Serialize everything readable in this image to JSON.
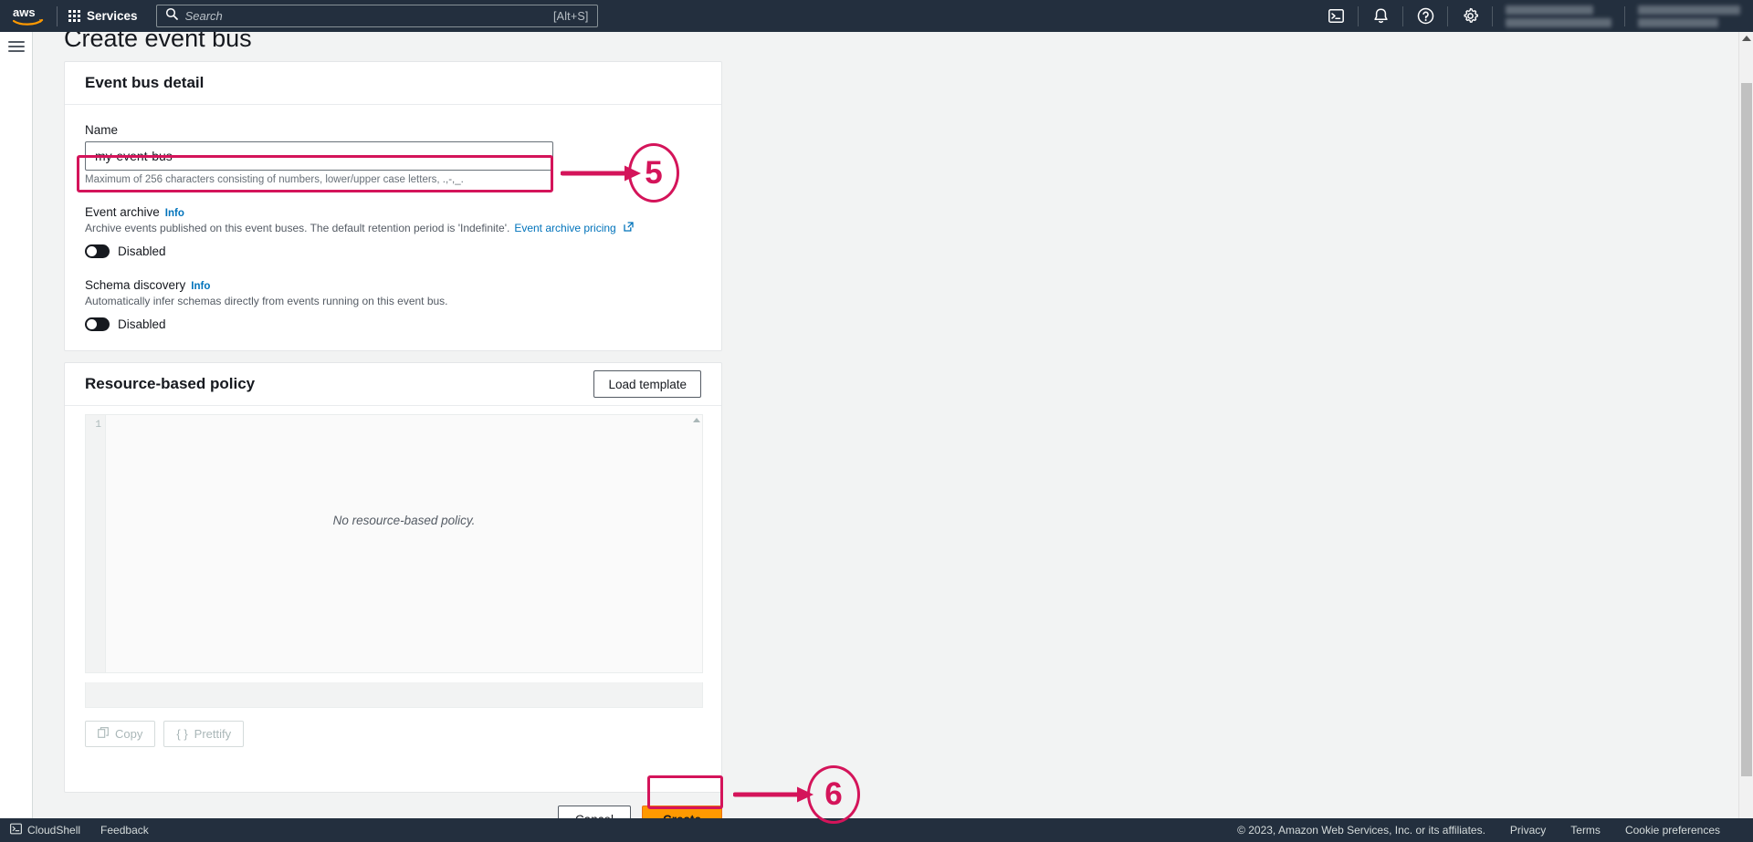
{
  "topnav": {
    "logo": "aws-logo",
    "services_label": "Services",
    "search_placeholder": "Search",
    "search_value": "",
    "search_hint": "[Alt+S]",
    "icons": [
      "cloudshell-icon",
      "bell-icon",
      "help-icon",
      "gear-icon"
    ],
    "account_blurred": "",
    "region_blurred": ""
  },
  "page": {
    "title": "Create event bus"
  },
  "detail_card": {
    "title": "Event bus detail",
    "name_label": "Name",
    "name_value": "my-event-bus",
    "name_placeholder": "",
    "name_hint": "Maximum of 256 characters consisting of numbers, lower/upper case letters, .,-,_.",
    "event_archive": {
      "label": "Event archive",
      "info": "Info",
      "description": "Archive events published on this event buses. The default retention period is 'Indefinite'.",
      "link": "Event archive pricing",
      "toggle_state": "Disabled"
    },
    "schema_discovery": {
      "label": "Schema discovery",
      "info": "Info",
      "description": "Automatically infer schemas directly from events running on this event bus.",
      "toggle_state": "Disabled"
    }
  },
  "policy_card": {
    "title": "Resource-based policy",
    "load_template_label": "Load template",
    "gutter_line": "1",
    "empty_text": "No resource-based policy.",
    "copy_label": "Copy",
    "prettify_label": "Prettify",
    "prettify_prefix": "{ }"
  },
  "actions": {
    "cancel_label": "Cancel",
    "create_label": "Create"
  },
  "bottombar": {
    "cloudshell_label": "CloudShell",
    "feedback_label": "Feedback",
    "copyright": "© 2023, Amazon Web Services, Inc. or its affiliates.",
    "privacy_label": "Privacy",
    "terms_label": "Terms",
    "cookie_label": "Cookie preferences"
  },
  "annotations": {
    "color": "#d4145a",
    "step5": "5",
    "step6": "6"
  }
}
